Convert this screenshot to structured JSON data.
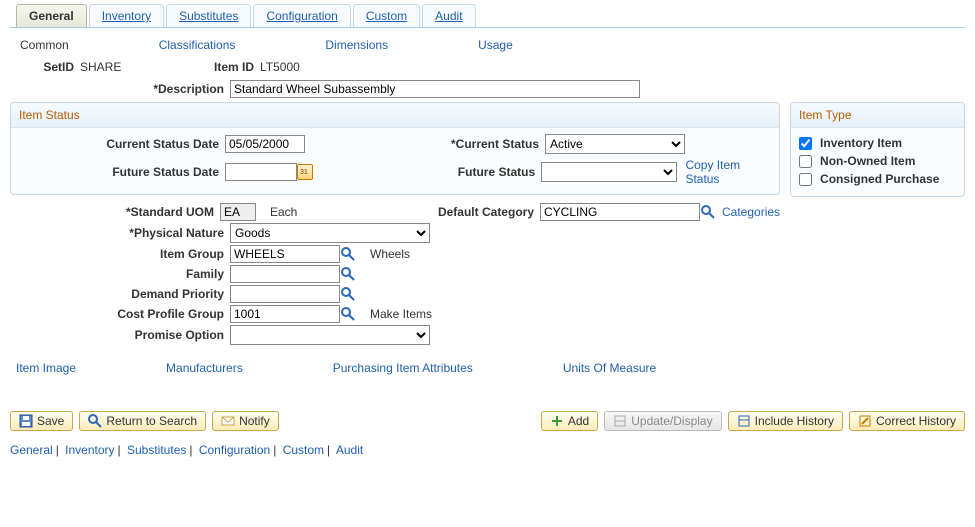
{
  "tabs": {
    "general": "General",
    "inventory": "Inventory",
    "substitutes": "Substitutes",
    "configuration": "Configuration",
    "custom": "Custom",
    "audit": "Audit"
  },
  "sub_tabs": {
    "common": "Common",
    "classifications": "Classifications",
    "dimensions": "Dimensions",
    "usage": "Usage"
  },
  "header": {
    "setid_label": "SetID",
    "setid_value": "SHARE",
    "itemid_label": "Item ID",
    "itemid_value": "LT5000"
  },
  "description": {
    "label": "*Description",
    "value": "Standard Wheel Subassembly"
  },
  "item_type": {
    "title": "Item Type",
    "inventory_item": "Inventory Item",
    "non_owned_item": "Non-Owned Item",
    "consigned_purchase": "Consigned Purchase",
    "inventory_item_checked": true,
    "non_owned_item_checked": false,
    "consigned_purchase_checked": false
  },
  "item_status": {
    "title": "Item Status",
    "current_status_date_label": "Current Status Date",
    "current_status_date_value": "05/05/2000",
    "current_status_label": "*Current Status",
    "current_status_value": "Active",
    "future_status_date_label": "Future Status Date",
    "future_status_date_value": "",
    "future_status_label": "Future Status",
    "future_status_value": "",
    "copy_item_status": "Copy Item Status"
  },
  "fields": {
    "standard_uom_label": "*Standard UOM",
    "standard_uom_value": "EA",
    "standard_uom_desc": "Each",
    "default_category_label": "Default Category",
    "default_category_value": "CYCLING",
    "categories_link": "Categories",
    "physical_nature_label": "*Physical Nature",
    "physical_nature_value": "Goods",
    "item_group_label": "Item Group",
    "item_group_value": "WHEELS",
    "item_group_desc": "Wheels",
    "family_label": "Family",
    "family_value": "",
    "demand_priority_label": "Demand Priority",
    "demand_priority_value": "",
    "cost_profile_group_label": "Cost Profile Group",
    "cost_profile_group_value": "1001",
    "cost_profile_group_desc": "Make Items",
    "promise_option_label": "Promise Option",
    "promise_option_value": ""
  },
  "bottom_links": {
    "item_image": "Item Image",
    "manufacturers": "Manufacturers",
    "purchasing_item_attributes": "Purchasing Item Attributes",
    "units_of_measure": "Units Of Measure"
  },
  "buttons": {
    "save": "Save",
    "return_to_search": "Return to Search",
    "notify": "Notify",
    "add": "Add",
    "update_display": "Update/Display",
    "include_history": "Include History",
    "correct_history": "Correct History"
  },
  "footer_links": [
    "General",
    "Inventory",
    "Substitutes",
    "Configuration",
    "Custom",
    "Audit"
  ]
}
